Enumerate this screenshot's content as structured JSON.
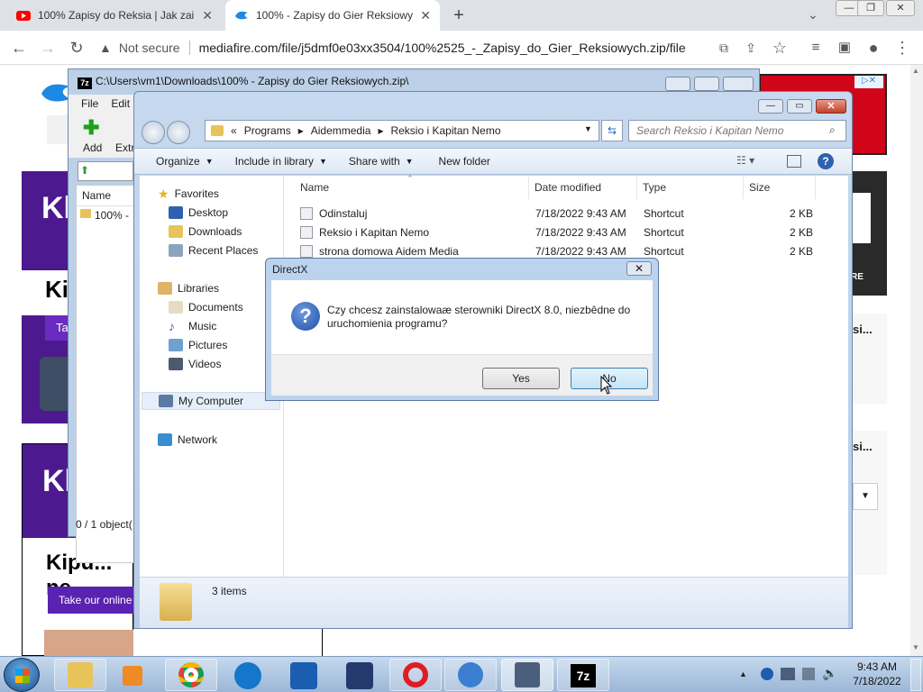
{
  "browser": {
    "tabs": [
      {
        "title": "100% Zapisy do Reksia | Jak zainst",
        "favicon": "youtube-icon",
        "color": "#ff0000"
      },
      {
        "title": "100% - Zapisy do Gier Reksiowy",
        "favicon": "mediafire-icon",
        "color": "#1e88e5"
      }
    ],
    "security": "Not secure",
    "url": "mediafire.com/file/j5dmf0e03xx3504/100%2525_-_Zapisy_do_Gier_Reksiowych.zip/file"
  },
  "page": {
    "ad_kl_1": "Kl",
    "ad_kip": "Kip",
    "ad_ta": "Ta",
    "ad_kl_2": "Kl",
    "ad_kipu": "Kipu... ne",
    "ad_take": "Take our online t",
    "ad_re": "RE",
    "side_si_1": "si...",
    "side_si_2": "si..."
  },
  "sevenzip": {
    "title": "C:\\Users\\vm1\\Downloads\\100% - Zapisy do Gier Reksiowych.zip\\",
    "menu": [
      "File",
      "Edit"
    ],
    "toolbar": [
      "Add",
      "Extr"
    ],
    "col_name": "Name",
    "row": "100% - ",
    "status": "0 / 1 object("
  },
  "explorer": {
    "breadcrumb": [
      "«",
      "Programs",
      "Aidemmedia",
      "Reksio i Kapitan Nemo"
    ],
    "search_placeholder": "Search Reksio i Kapitan Nemo",
    "commands": [
      "Organize",
      "Include in library",
      "Share with",
      "New folder"
    ],
    "nav": {
      "favorites": "Favorites",
      "desktop": "Desktop",
      "downloads": "Downloads",
      "recent": "Recent Places",
      "libraries": "Libraries",
      "documents": "Documents",
      "music": "Music",
      "pictures": "Pictures",
      "videos": "Videos",
      "computer": "My Computer",
      "network": "Network"
    },
    "columns": [
      "Name",
      "Date modified",
      "Type",
      "Size"
    ],
    "files": [
      {
        "name": "Odinstaluj",
        "date": "7/18/2022 9:43 AM",
        "type": "Shortcut",
        "size": "2 KB"
      },
      {
        "name": "Reksio i Kapitan Nemo",
        "date": "7/18/2022 9:43 AM",
        "type": "Shortcut",
        "size": "2 KB"
      },
      {
        "name": "strona domowa Aidem Media",
        "date": "7/18/2022 9:43 AM",
        "type": "Shortcut",
        "size": "2 KB"
      }
    ],
    "status": "3 items"
  },
  "dialog": {
    "title": "DirectX",
    "message": "Czy chcesz zainstalowaæ sterowniki DirectX 8.0, niezbêdne do uruchomienia programu?",
    "yes": "Yes",
    "no": "No"
  },
  "taskbar": {
    "time": "9:43 AM",
    "date": "7/18/2022"
  }
}
